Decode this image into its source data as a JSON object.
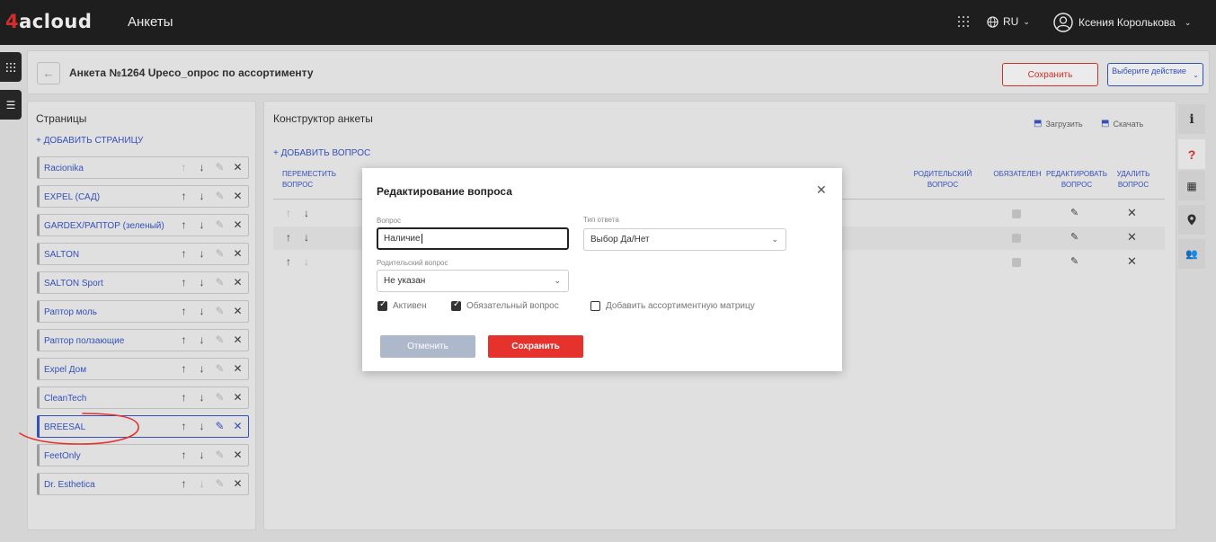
{
  "topbar": {
    "logo_prefix": "4",
    "logo_text": "acloud",
    "app_title": "Анкеты",
    "language": "RU",
    "user_name": "Ксения Королькова",
    "icons": {
      "apps": "grid-icon",
      "globe": "globe-icon",
      "user": "user-circle-icon",
      "chevron": "chevron-down-icon"
    }
  },
  "header": {
    "title": "Анкета №1264 Upeco_опрос по ассортименту",
    "save_label": "Сохранить",
    "action_label": "Выберите действие"
  },
  "pages_panel": {
    "title": "Страницы",
    "add_label": "+ ДОБАВИТЬ СТРАНИЦУ",
    "pages": [
      {
        "name": "Racionika"
      },
      {
        "name": "EXPEL (САД)"
      },
      {
        "name": "GARDEX/РАПТОР (зеленый)"
      },
      {
        "name": "SALTON"
      },
      {
        "name": "SALTON Sport"
      },
      {
        "name": "Раптор моль"
      },
      {
        "name": "Раптор ползающие"
      },
      {
        "name": "Expel Дом"
      },
      {
        "name": "CleanTech"
      },
      {
        "name": "BREESAL"
      },
      {
        "name": "FeetOnly"
      },
      {
        "name": "Dr. Esthetica"
      }
    ],
    "selected_index": 9
  },
  "constructor": {
    "title": "Конструктор анкеты",
    "upload_label": "Загрузить",
    "download_label": "Скачать",
    "add_question_label": "+ ДОБАВИТЬ ВОПРОС",
    "columns": {
      "move": "ПЕРЕМЕСТИТЬ ВОПРОС",
      "parent": "РОДИТЕЛЬСКИЙ ВОПРОС",
      "required": "ОБЯЗАТЕЛЕН",
      "edit": "РЕДАКТИРОВАТЬ ВОПРОС",
      "delete": "УДАЛИТЬ ВОПРОС"
    },
    "row_count": 3
  },
  "modal": {
    "title": "Редактирование вопроса",
    "question_label": "Вопрос",
    "question_value": "Наличие",
    "answer_type_label": "Тип ответа",
    "answer_type_value": "Выбор Да/Нет",
    "parent_label": "Родительский вопрос",
    "parent_value": "Не указан",
    "active_label": "Активен",
    "active_checked": true,
    "required_label": "Обязательный вопрос",
    "required_checked": true,
    "matrix_label": "Добавить ассортиментную матрицу",
    "matrix_checked": false,
    "cancel_label": "Отменить",
    "save_label": "Сохранить"
  },
  "colors": {
    "brand_red": "#e5322d",
    "link_blue": "#3a56c8",
    "topbar": "#212121"
  }
}
